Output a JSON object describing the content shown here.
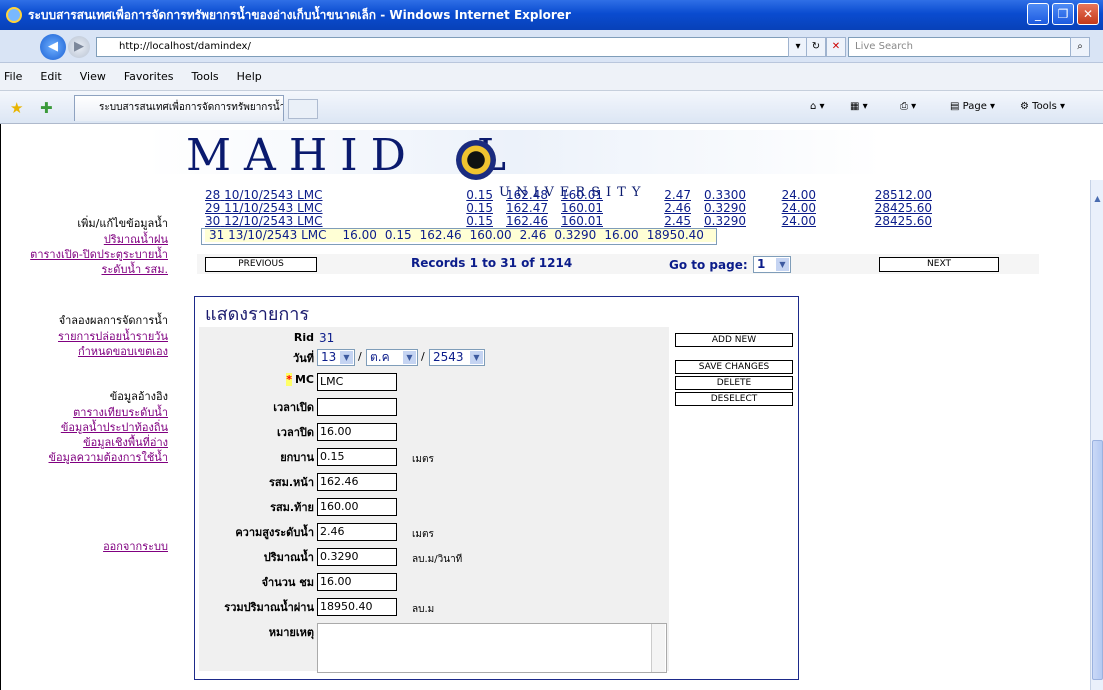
{
  "window": {
    "title": "ระบบสารสนเทศเพื่อการจัดการทรัพยากรน้ำของอ่างเก็บน้ำขนาดเล็ก - Windows Internet Explorer"
  },
  "address": {
    "url": "http://localhost/damindex/",
    "search_placeholder": "Live Search"
  },
  "menu": [
    "File",
    "Edit",
    "View",
    "Favorites",
    "Tools",
    "Help"
  ],
  "tab": {
    "label": "ระบบสารสนเทศเพื่อการจัดการทรัพยากรน้ำของอ่างเก็บน้...",
    "page_label": "Page",
    "tools_label": "Tools"
  },
  "logo": {
    "text": "MAHID",
    "text2": "L",
    "university": "UNIVERSITY"
  },
  "sidebar": {
    "group1_head": "เพิ่ม/แก้ไขข้อมูลน้ำ",
    "group1_items": [
      "ปริมาณน้ำฝน",
      "ตารางเปิด-ปิดประตูระบายน้ำ",
      "ระดับน้ำ รสม."
    ],
    "group2_head": "จำลองผลการจัดการน้ำ",
    "group2_items": [
      "รายการปล่อยน้ำรายวัน",
      "กำหนดขอบเขตเอง"
    ],
    "group3_head": "ข้อมูลอ้างอิง",
    "group3_items": [
      "ตารางเทียบระดับน้ำ",
      "ข้อมูลน้ำประปาท้องถิ่น",
      "ข้อมูลเชิงพื้นที่อ่าง",
      "ข้อมูลความต้องการใช้น้ำ"
    ],
    "logout": "ออกจากระบบ"
  },
  "rows": [
    {
      "no": "28",
      "date": "10/10/2543",
      "mc": "LMC",
      "open": "",
      "close": "",
      "gate": "0.15",
      "up": "162.48",
      "down": "160.01",
      "h": "2.47",
      "q": "0.3300",
      "n": "24.00",
      "total": "28512.00"
    },
    {
      "no": "29",
      "date": "11/10/2543",
      "mc": "LMC",
      "open": "",
      "close": "",
      "gate": "0.15",
      "up": "162.47",
      "down": "160.01",
      "h": "2.46",
      "q": "0.3290",
      "n": "24.00",
      "total": "28425.60"
    },
    {
      "no": "30",
      "date": "12/10/2543",
      "mc": "LMC",
      "open": "",
      "close": "",
      "gate": "0.15",
      "up": "162.46",
      "down": "160.01",
      "h": "2.45",
      "q": "0.3290",
      "n": "24.00",
      "total": "28425.60"
    },
    {
      "no": "31",
      "date": "13/10/2543",
      "mc": "LMC",
      "open": "",
      "close": "16.00",
      "gate": "0.15",
      "up": "162.46",
      "down": "160.00",
      "h": "2.46",
      "q": "0.3290",
      "n": "16.00",
      "total": "18950.40"
    }
  ],
  "pager": {
    "previous": "PREVIOUS",
    "records": "Records 1 to 31 of 1214",
    "goto": "Go to page:",
    "page": "1",
    "next": "NEXT"
  },
  "form": {
    "title": "แสดงรายการ",
    "rid_label": "Rid",
    "rid_value": "31",
    "date_label": "วันที่",
    "day": "13",
    "month": "ต.ค",
    "year": "2543",
    "mc_label": "MC",
    "mc_value": "LMC",
    "open_label": "เวลาเปิด",
    "open_value": "",
    "close_label": "เวลาปิด",
    "close_value": "16.00",
    "gate_label": "ยกบาน",
    "gate_value": "0.15",
    "gate_unit": "เมตร",
    "up_label": "รสม.หน้า",
    "up_value": "162.46",
    "down_label": "รสม.ท้าย",
    "down_value": "160.00",
    "h_label": "ความสูงระดับน้ำ",
    "h_value": "2.46",
    "h_unit": "เมตร",
    "q_label": "ปริมาณน้ำ",
    "q_value": "0.3290",
    "q_unit": "ลบ.ม/วินาที",
    "n_label": "จำนวน ชม",
    "n_value": "16.00",
    "total_label": "รวมปริมาณน้ำผ่าน",
    "total_value": "18950.40",
    "total_unit": "ลบ.ม",
    "note_label": "หมายเหตุ",
    "btn_add": "ADD NEW",
    "btn_save": "SAVE CHANGES",
    "btn_delete": "DELETE",
    "btn_deselect": "DESELECT"
  }
}
